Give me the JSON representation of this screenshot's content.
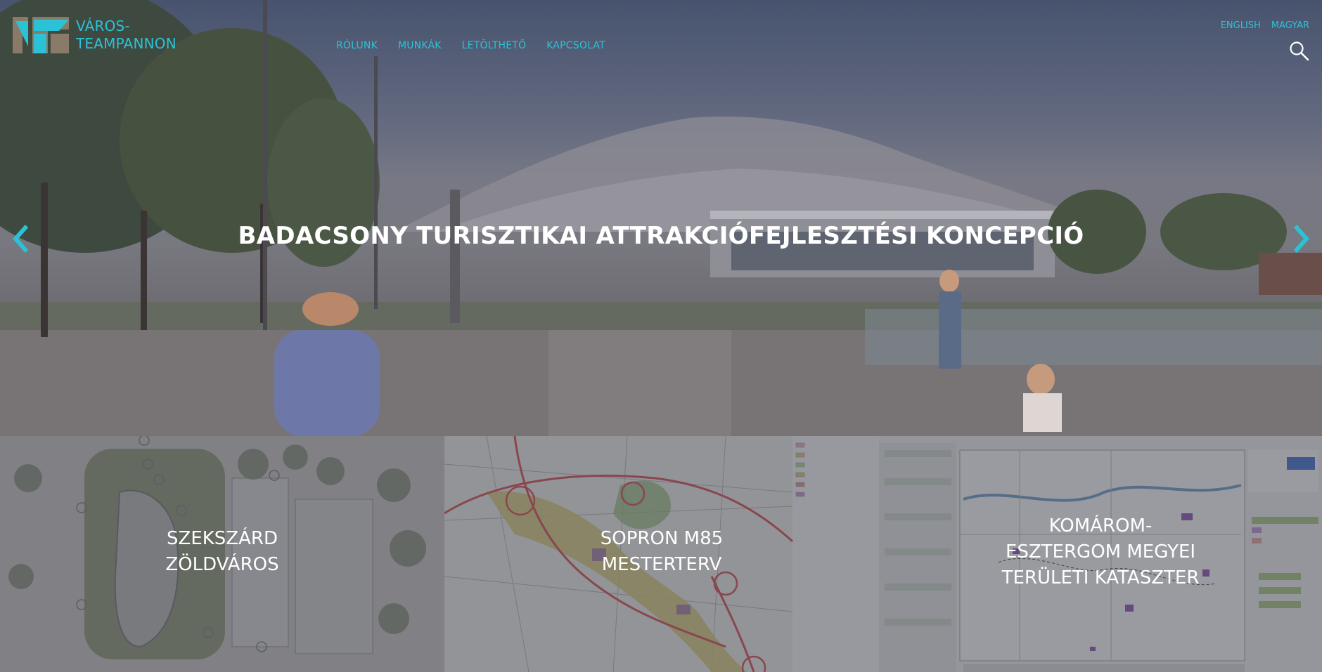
{
  "brand": {
    "line1": "VÁROS-",
    "line2": "TEAMPANNON"
  },
  "nav": {
    "items": [
      "RÓLUNK",
      "MUNKÁK",
      "LETÖLTHETŐ",
      "KAPCSOLAT"
    ]
  },
  "languages": [
    "ENGLISH",
    "MAGYAR"
  ],
  "hero": {
    "title": "BADACSONY TURISZTIKAI ATTRAKCIÓFEJLESZTÉSI KONCEPCIÓ"
  },
  "tiles": [
    {
      "lines": [
        "SZEKSZÁRD",
        "ZÖLDVÁROS"
      ]
    },
    {
      "lines": [
        "SOPRON M85",
        "MESTERTERV"
      ]
    },
    {
      "lines": [
        "KOMÁROM-",
        "ESZTERGOM MEGYEI",
        "TERÜLETI KATASZTER"
      ]
    }
  ],
  "colors": {
    "accent": "#2cc2d6",
    "logo_brown": "#8a7a68"
  },
  "icons": {
    "search": "search-icon",
    "prev": "chevron-left-icon",
    "next": "chevron-right-icon"
  }
}
